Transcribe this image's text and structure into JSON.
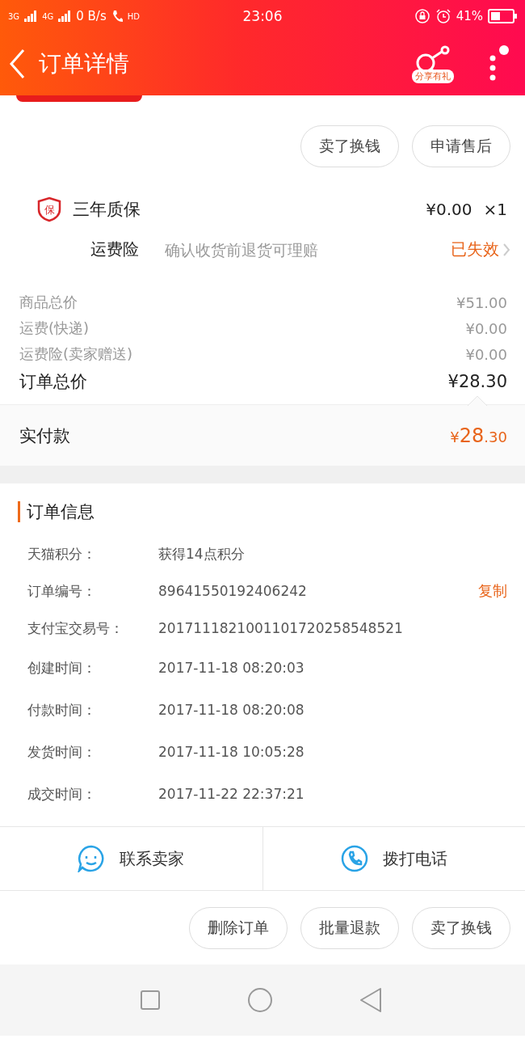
{
  "status_bar": {
    "network_1": "3G",
    "network_2": "4G",
    "speed": "0 B/s",
    "call": "HD",
    "time": "23:06",
    "battery": "41%"
  },
  "header": {
    "title": "订单详情",
    "share_label": "分享有礼"
  },
  "top_actions": [
    "卖了换钱",
    "申请售后"
  ],
  "service": {
    "icon": "保",
    "name": "三年质保",
    "price": "¥0.00",
    "quantity": "×1"
  },
  "insurance": {
    "label": "运费险",
    "description": "确认收货前退货可理赔",
    "status": "已失效"
  },
  "fees": [
    {
      "label": "商品总价",
      "value": "¥51.00",
      "kind": "minor"
    },
    {
      "label": "运费(快递)",
      "value": "¥0.00",
      "kind": "minor"
    },
    {
      "label": "运费险(卖家赠送)",
      "value": "¥0.00",
      "kind": "minor"
    },
    {
      "label": "订单总价",
      "value": "¥28.30",
      "kind": "total"
    }
  ],
  "paid": {
    "label": "实付款",
    "currency": "¥",
    "integer": "28",
    "decimal": ".30"
  },
  "order_info": {
    "title": "订单信息",
    "rows": [
      {
        "label": "天猫积分：",
        "value": "获得14点积分"
      },
      {
        "label": "订单编号：",
        "value": "89641550192406242",
        "action": "复制"
      },
      {
        "label": "支付宝交易号：",
        "value": "2017111821001101720258548521"
      },
      {
        "label": "创建时间：",
        "value": "2017-11-18 08:20:03"
      },
      {
        "label": "付款时间：",
        "value": "2017-11-18 08:20:08"
      },
      {
        "label": "发货时间：",
        "value": "2017-11-18 10:05:28"
      },
      {
        "label": "成交时间：",
        "value": "2017-11-22 22:37:21"
      }
    ]
  },
  "contact": [
    {
      "label": "联系卖家",
      "kind": "chat"
    },
    {
      "label": "拨打电话",
      "kind": "phone"
    }
  ],
  "bottom_actions": [
    "删除订单",
    "批量退款",
    "卖了换钱"
  ]
}
